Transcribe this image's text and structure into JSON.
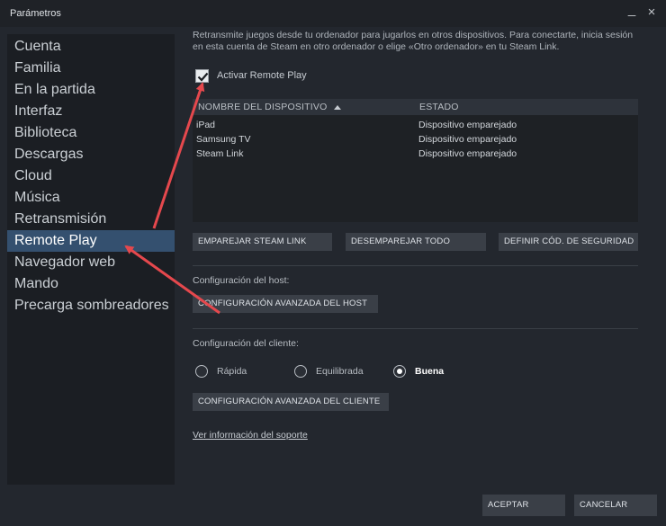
{
  "window": {
    "title": "Parámetros",
    "minimize_glyph": "_",
    "close_glyph": "×"
  },
  "sidebar": {
    "items": [
      {
        "label": "Cuenta"
      },
      {
        "label": "Familia"
      },
      {
        "label": "En la partida"
      },
      {
        "label": "Interfaz"
      },
      {
        "label": "Biblioteca"
      },
      {
        "label": "Descargas"
      },
      {
        "label": "Cloud"
      },
      {
        "label": "Música"
      },
      {
        "label": "Retransmisión"
      },
      {
        "label": "Remote Play"
      },
      {
        "label": "Navegador web"
      },
      {
        "label": "Mando"
      },
      {
        "label": "Precarga sombreadores"
      }
    ],
    "active": "Remote Play"
  },
  "main": {
    "description": "Retransmite juegos desde tu ordenador para jugarlos en otros dispositivos. Para conectarte, inicia sesión en esta cuenta de Steam en otro ordenador o elige «Otro ordenador» en tu Steam Link.",
    "enable_checkbox": {
      "label": "Activar Remote Play",
      "checked": true
    },
    "devices_table": {
      "headers": [
        "NOMBRE DEL DISPOSITIVO",
        "ESTADO"
      ],
      "sort_icon": "caret-up-icon",
      "rows": [
        {
          "name": "iPad",
          "status": "Dispositivo emparejado"
        },
        {
          "name": "Samsung TV",
          "status": "Dispositivo emparejado"
        },
        {
          "name": "Steam Link",
          "status": "Dispositivo emparejado"
        }
      ]
    },
    "pair_buttons": {
      "pair": "EMPAREJAR STEAM LINK",
      "unpair_all": "DESEMPAREJAR TODO",
      "security_code": "DEFINIR CÓD. DE SEGURIDAD"
    },
    "host": {
      "label": "Configuración del host:",
      "advanced_button": "CONFIGURACIÓN AVANZADA DEL HOST"
    },
    "client": {
      "label": "Configuración del cliente:",
      "options": [
        {
          "label": "Rápida",
          "selected": false
        },
        {
          "label": "Equilibrada",
          "selected": false
        },
        {
          "label": "Buena",
          "selected": true
        }
      ],
      "advanced_button": "CONFIGURACIÓN AVANZADA DEL CLIENTE"
    },
    "support_link": "Ver información del soporte"
  },
  "footer": {
    "accept": "ACEPTAR",
    "cancel": "CANCELAR"
  },
  "colors": {
    "window_bg": "#23272e",
    "sidebar_bg": "#1b1e23",
    "active_item_bg": "#34506f",
    "button_bg": "#3a3f47",
    "annotation_arrow": "#e5484d"
  }
}
